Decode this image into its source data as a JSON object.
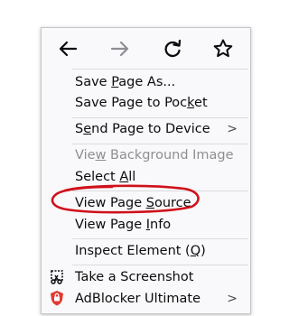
{
  "nav": {
    "back_icon": "arrow-left-icon",
    "forward_icon": "arrow-right-icon",
    "reload_icon": "reload-icon",
    "bookmark_icon": "star-outline-icon"
  },
  "menu": {
    "save_as": {
      "pre": "Save ",
      "key": "P",
      "post": "age As..."
    },
    "pocket": {
      "pre": "Save Page to Poc",
      "key": "k",
      "post": "et"
    },
    "send": {
      "pre": "S",
      "key": "e",
      "post": "nd Page to Device",
      "arrow": ">"
    },
    "bg_image": {
      "pre": "Vie",
      "key": "w",
      "post": " Background Image"
    },
    "select_all": {
      "pre": "Select ",
      "key": "A",
      "post": "ll"
    },
    "view_source": {
      "pre": "View Page ",
      "key": "S",
      "post": "ource"
    },
    "page_info": {
      "pre": "View Page ",
      "key": "I",
      "post": "nfo"
    },
    "inspect": {
      "pre": "Inspect Element (",
      "key": "Q",
      "post": ")"
    },
    "screenshot": {
      "label": "Take a Screenshot",
      "icon": "screenshot-icon"
    },
    "adblocker": {
      "label": "AdBlocker Ultimate",
      "arrow": ">",
      "icon": "adblocker-shield-icon"
    }
  },
  "colors": {
    "annotation": "#d0101a",
    "disabled_text": "#8f8f93",
    "menu_bg": "#f9f9fb"
  }
}
